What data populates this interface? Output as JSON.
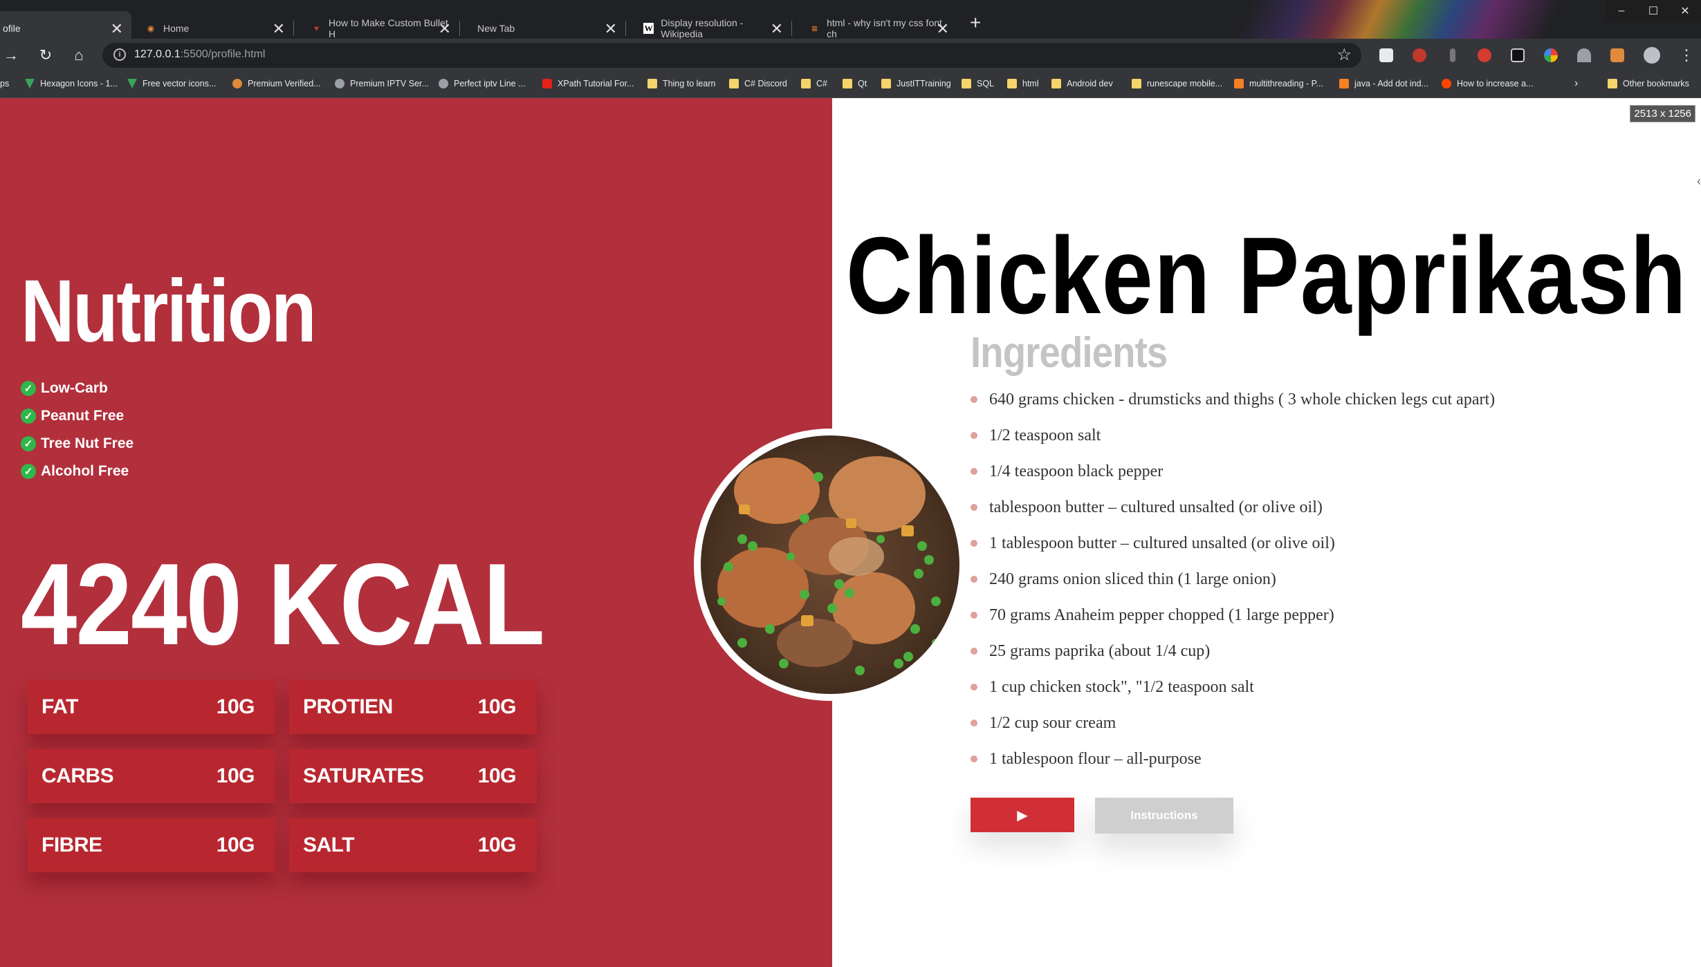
{
  "browser": {
    "tabs": [
      {
        "title": "ofile",
        "favicon": "page-icon",
        "active": true
      },
      {
        "title": "Home",
        "favicon": "circle-icon"
      },
      {
        "title": "How to Make Custom Bullet H",
        "favicon": "heart-icon"
      },
      {
        "title": "New Tab",
        "favicon": ""
      },
      {
        "title": "Display resolution - Wikipedia",
        "favicon": "wikipedia-icon"
      },
      {
        "title": "html - why isn't my css font ch",
        "favicon": "stackoverflow-icon"
      }
    ],
    "url_host": "127.0.0.1",
    "url_path": ":5500/profile.html",
    "bookmarks": [
      {
        "label": "ps",
        "icon": "apps-icon"
      },
      {
        "label": "Hexagon Icons - 1...",
        "icon": "hexagon-icon"
      },
      {
        "label": "Free vector icons...",
        "icon": "hexagon-icon"
      },
      {
        "label": "Premium Verified...",
        "icon": "person-icon"
      },
      {
        "label": "Premium IPTV Ser...",
        "icon": "globe-icon"
      },
      {
        "label": "Perfect iptv Line ...",
        "icon": "globe-icon"
      },
      {
        "label": "XPath Tutorial For...",
        "icon": "youtube-icon"
      },
      {
        "label": "Thing to learn",
        "icon": "folder-icon"
      },
      {
        "label": "C# Discord",
        "icon": "folder-icon"
      },
      {
        "label": "C#",
        "icon": "folder-icon"
      },
      {
        "label": "Qt",
        "icon": "folder-icon"
      },
      {
        "label": "JustITTraining",
        "icon": "folder-icon"
      },
      {
        "label": "SQL",
        "icon": "folder-icon"
      },
      {
        "label": "html",
        "icon": "folder-icon"
      },
      {
        "label": "Android dev",
        "icon": "folder-icon"
      },
      {
        "label": "runescape mobile...",
        "icon": "folder-icon"
      },
      {
        "label": "multithreading - P...",
        "icon": "stackoverflow-icon"
      },
      {
        "label": "java - Add dot ind...",
        "icon": "stackoverflow-icon"
      },
      {
        "label": "How to increase a...",
        "icon": "reddit-icon"
      }
    ],
    "other_bookmarks": "Other bookmarks",
    "colors": {
      "tabbar": "#202124",
      "toolbar": "#35363a"
    }
  },
  "page": {
    "resolution_badge": "2513 x 1256",
    "nutrition": {
      "title": "Nutrition",
      "diets": [
        "Low-Carb",
        "Peanut Free",
        "Tree Nut Free",
        "Alcohol Free"
      ],
      "calories": "4240 KCAL",
      "macros": [
        {
          "label": "FAT",
          "value": "10G"
        },
        {
          "label": "PROTIEN",
          "value": "10G"
        },
        {
          "label": "CARBS",
          "value": "10G"
        },
        {
          "label": "SATURATES",
          "value": "10G"
        },
        {
          "label": "FIBRE",
          "value": "10G"
        },
        {
          "label": "SALT",
          "value": "10G"
        }
      ]
    },
    "recipe": {
      "title": "Chicken Paprikash",
      "ingredients_heading": "Ingredients",
      "ingredients": [
        "640 grams chicken - drumsticks and thighs ( 3 whole chicken legs cut apart)",
        "1/2 teaspoon salt",
        "1/4 teaspoon black pepper",
        "tablespoon butter – cultured unsalted (or olive oil)",
        "1 tablespoon butter – cultured unsalted (or olive oil)",
        "240 grams onion sliced thin (1 large onion)",
        "70 grams Anaheim pepper chopped (1 large pepper)",
        "25 grams paprika (about 1/4 cup)",
        "1 cup chicken stock\", \"1/2 teaspoon salt",
        "1/2 cup sour cream",
        "1 tablespoon flour – all-purpose"
      ],
      "play_button_icon": "play-icon",
      "instructions_button": "Instructions"
    },
    "colors": {
      "left_panel": "#b22f3c",
      "macro_card": "#b8272f",
      "check": "#2fb84a",
      "play_button": "#d12f36",
      "instructions_button": "#cfcfcf",
      "bullet": "#dfa19a"
    }
  }
}
